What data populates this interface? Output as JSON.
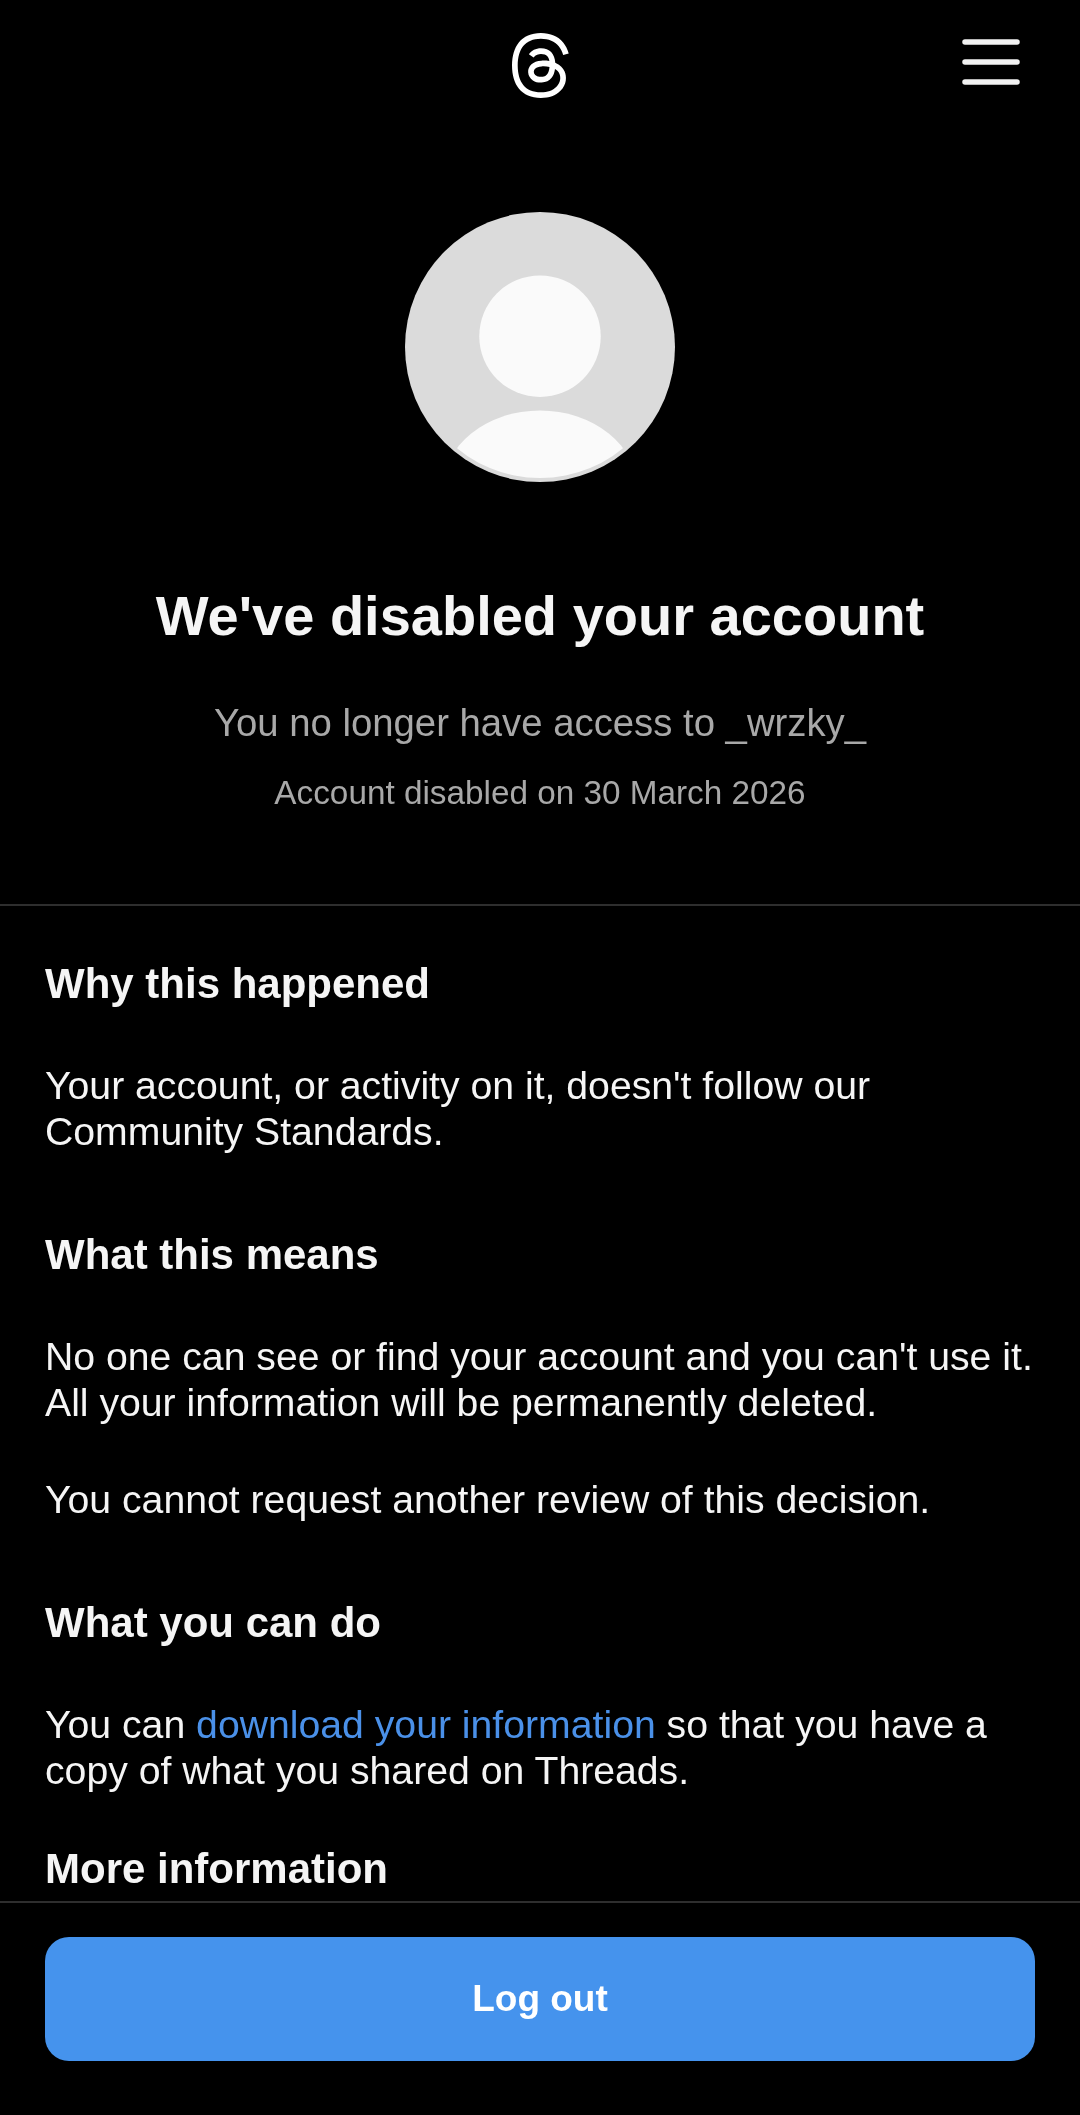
{
  "header": {
    "title": "We've disabled your account",
    "subtitle": "You no longer have access to _wrzky_",
    "date_line": "Account disabled on 30 March 2026"
  },
  "sections": [
    {
      "heading": "Why this happened",
      "paragraphs": [
        {
          "parts": [
            {
              "kind": "text",
              "text": "Your account, or activity on it, doesn't follow our Community Standards."
            }
          ]
        }
      ]
    },
    {
      "heading": "What this means",
      "paragraphs": [
        {
          "parts": [
            {
              "kind": "text",
              "text": "No one can see or find your account and you can't use it. All your information will be permanently deleted."
            }
          ]
        },
        {
          "parts": [
            {
              "kind": "text",
              "text": "You cannot request another review of this decision."
            }
          ]
        }
      ]
    },
    {
      "heading": "What you can do",
      "paragraphs": [
        {
          "parts": [
            {
              "kind": "text",
              "text": "You can "
            },
            {
              "kind": "link",
              "text": "download your information"
            },
            {
              "kind": "text",
              "text": " so that you have a copy of what you shared on Threads."
            }
          ]
        }
      ]
    },
    {
      "heading": "More information"
    }
  ],
  "footer": {
    "button": "Log out"
  }
}
